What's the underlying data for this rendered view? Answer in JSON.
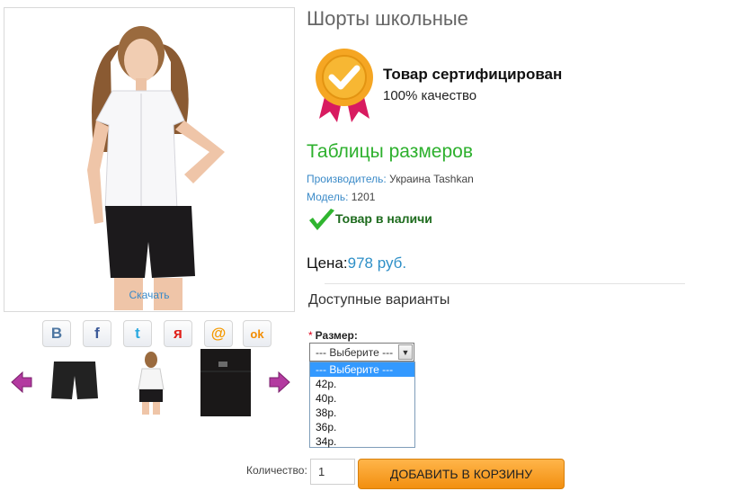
{
  "product": {
    "title": "Шорты школьные",
    "download_link": "Скачать",
    "certificate": {
      "title": "Товар сертифицирован",
      "subtitle": "100% качество",
      "icon": "certificate-badge-icon"
    },
    "size_tables_link": "Таблицы размеров",
    "manufacturer": {
      "label": "Производитель:",
      "value": "Украина Tashkan"
    },
    "model": {
      "label": "Модель:",
      "value": "1201"
    },
    "stock": {
      "text": "Товар в наличи",
      "icon": "checkmark-icon"
    },
    "price": {
      "label": "Цена:",
      "value": "978 руб."
    }
  },
  "share": [
    {
      "name": "vk-icon",
      "glyph": "B",
      "color": "#4d76a1"
    },
    {
      "name": "facebook-icon",
      "glyph": "f",
      "color": "#3b5998"
    },
    {
      "name": "twitter-icon",
      "glyph": "t",
      "color": "#2aa9e0"
    },
    {
      "name": "yandex-icon",
      "glyph": "я",
      "color": "#e0201a"
    },
    {
      "name": "mail-icon",
      "glyph": "@",
      "color": "#f59a00"
    },
    {
      "name": "odnoklassniki-icon",
      "glyph": "ok",
      "color": "#f28c00"
    }
  ],
  "options": {
    "heading": "Доступные варианты",
    "size": {
      "label": "Размер:",
      "required_mark": "*",
      "selected": "--- Выберите ---",
      "items": [
        "--- Выберите ---",
        "42р.",
        "40р.",
        "38р.",
        "36р.",
        "34р."
      ]
    }
  },
  "cart": {
    "qty_label": "Количество:",
    "qty_value": "1",
    "add_button": "ДОБАВИТЬ В КОРЗИНУ"
  }
}
